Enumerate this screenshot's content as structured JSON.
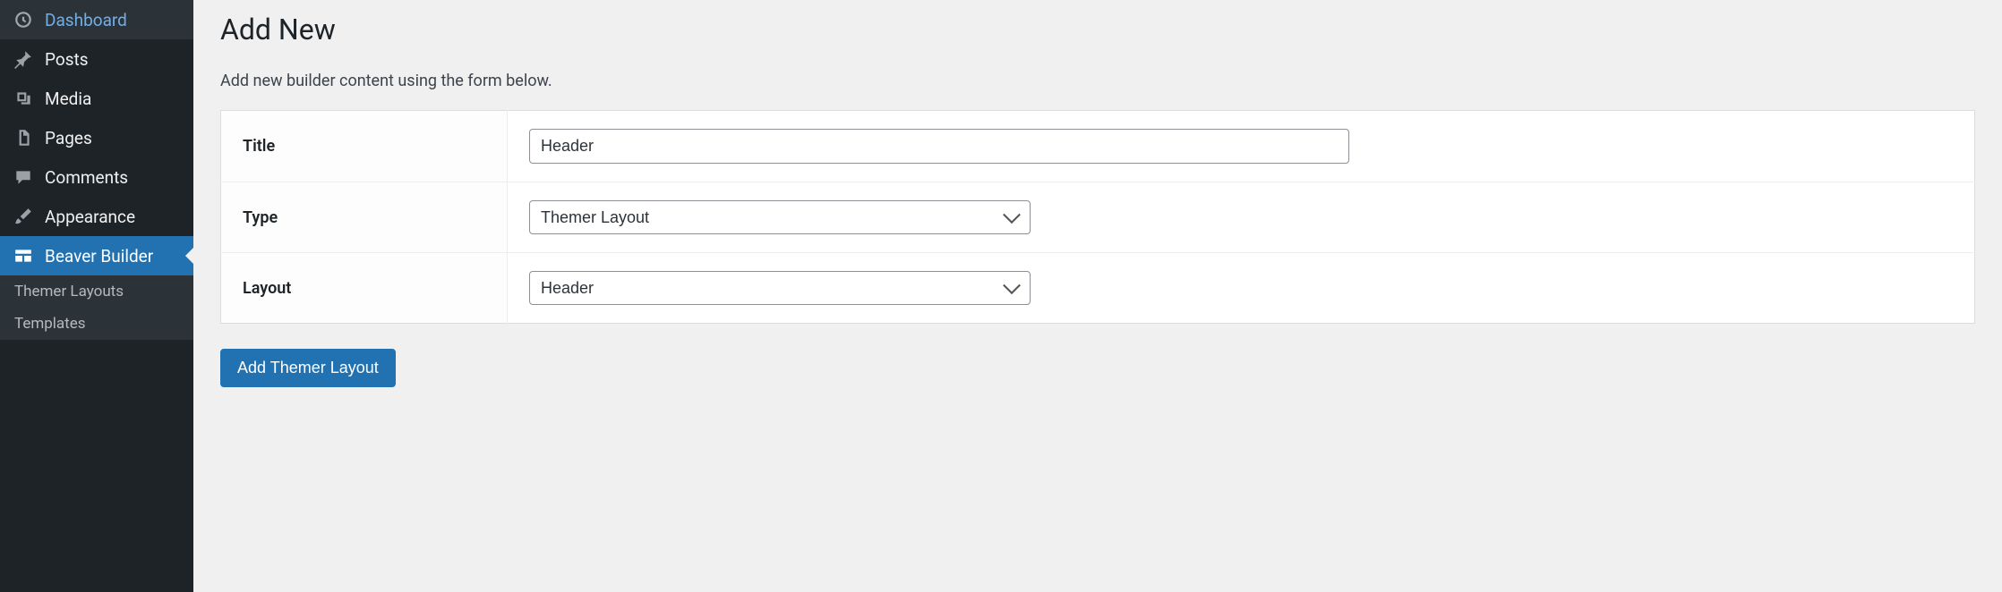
{
  "sidebar": {
    "items": [
      {
        "label": "Dashboard",
        "icon": "dashboard"
      },
      {
        "label": "Posts",
        "icon": "pin"
      },
      {
        "label": "Media",
        "icon": "media"
      },
      {
        "label": "Pages",
        "icon": "pages"
      },
      {
        "label": "Comments",
        "icon": "comment"
      },
      {
        "label": "Appearance",
        "icon": "brush"
      },
      {
        "label": "Beaver Builder",
        "icon": "builder",
        "active": true
      }
    ],
    "submenu": [
      {
        "label": "Themer Layouts"
      },
      {
        "label": "Templates"
      }
    ]
  },
  "main": {
    "title": "Add New",
    "intro": "Add new builder content using the form below.",
    "form": {
      "title_label": "Title",
      "title_value": "Header",
      "type_label": "Type",
      "type_value": "Themer Layout",
      "layout_label": "Layout",
      "layout_value": "Header"
    },
    "submit_label": "Add Themer Layout"
  }
}
